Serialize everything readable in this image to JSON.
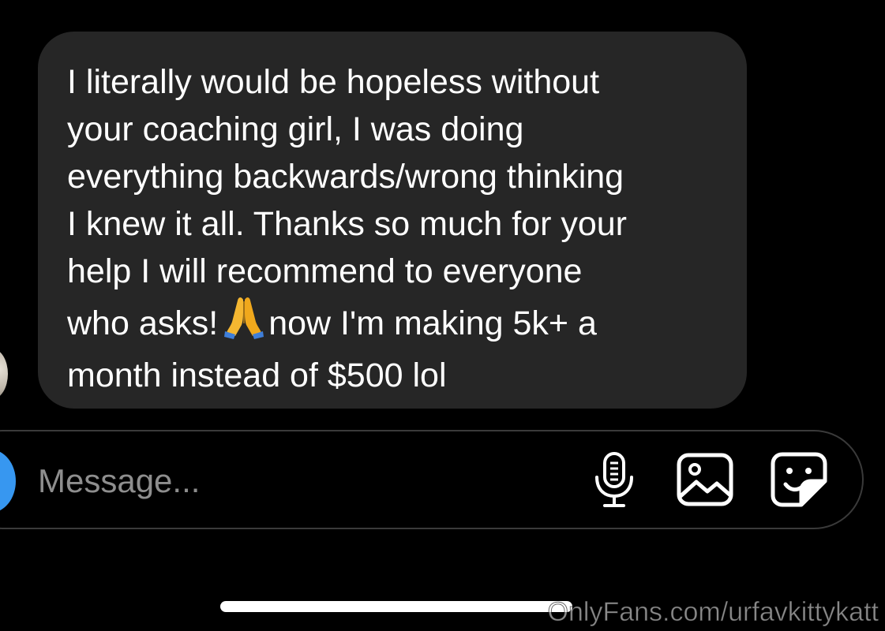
{
  "message": {
    "line1": "I literally would be hopeless without",
    "line2": "your coaching girl, I was doing",
    "line3": "everything backwards/wrong thinking",
    "line4": "I knew it all. Thanks so much for your",
    "line5": "help I will recommend to everyone",
    "line6a": "who asks!",
    "emoji": "🙏",
    "line6b": "now I'm making 5k+ a",
    "line7": "month instead of $500 lol"
  },
  "composer": {
    "placeholder": "Message..."
  },
  "icons": {
    "mic": "microphone-icon",
    "gallery": "image-icon",
    "sticker": "sticker-icon",
    "camera": "camera-icon"
  },
  "watermark": "OnlyFans.com/urfavkittykatt",
  "colors": {
    "background": "#000000",
    "bubble": "#262626",
    "accent": "#3797f0",
    "placeholder": "#8e8e8e"
  }
}
